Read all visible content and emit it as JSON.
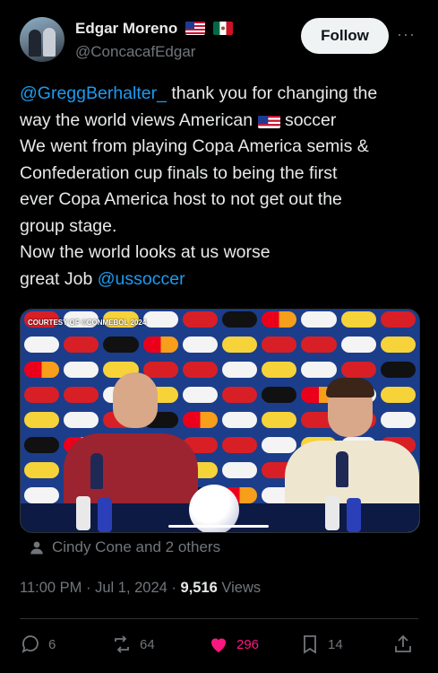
{
  "author": {
    "name": "Edgar Moreno",
    "handle": "@ConcacafEdgar",
    "flags": [
      "us-flag",
      "mexico-flag"
    ]
  },
  "follow_label": "Follow",
  "more_label": "···",
  "tweet": {
    "lines": [
      {
        "mention": "@GreggBerhalter_",
        "text": " thank you for changing the"
      },
      {
        "text": "way the world views American ",
        "flag": "us-flag",
        "text_after": " soccer"
      },
      {
        "text": "We went from playing Copa America semis &"
      },
      {
        "text": "Confederation cup finals to being the first"
      },
      {
        "text": "ever Copa America host to not get out the"
      },
      {
        "text": "group stage."
      },
      {
        "text": "Now the world looks at us worse"
      },
      {
        "text": "great Job ",
        "mention_after": "@ussoccer"
      }
    ]
  },
  "media": {
    "credit": "COURTESY OF ©CONMEBOL 2024",
    "sponsors": [
      "Betano",
      "Coca-Cola",
      "Degree",
      "mercado libre",
      "ULTRA",
      "LATAM",
      "Rexona",
      "PUMA",
      "Mastercard"
    ],
    "table_text": "CONMEBOL"
  },
  "liked_by": "Cindy Cone and 2 others",
  "meta": {
    "time": "11:00 PM",
    "date": "Jul 1, 2024",
    "views_count": "9,516",
    "views_label": "Views"
  },
  "actions": {
    "replies": "6",
    "reposts": "64",
    "likes": "296",
    "bookmarks": "14"
  },
  "colors": {
    "accent": "#1d9bf0",
    "like": "#f91880",
    "muted": "#71767b",
    "text": "#e7e9ea"
  }
}
